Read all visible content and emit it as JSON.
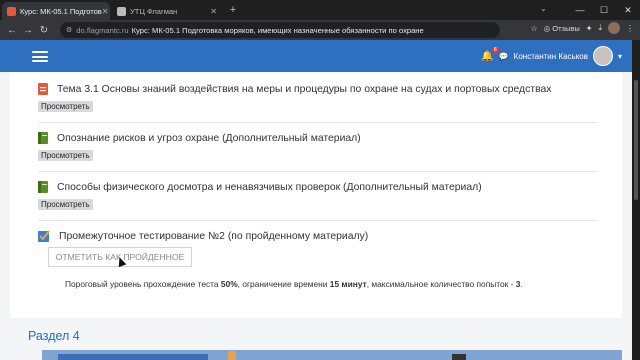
{
  "browser": {
    "tabs": [
      {
        "title": "Курс: МК-05.1 Подготов",
        "active": true
      },
      {
        "title": "УТЦ Флагман",
        "active": false
      }
    ],
    "new_tab_glyph": "+",
    "address": {
      "domain": "do.flagmantc.ru",
      "page_title": "Курс: МК-05.1 Подготовка моряков, имеющих назначенные обязанности по охране"
    },
    "reviews_label": "Отзывы"
  },
  "header": {
    "notification_count": "8",
    "user_name": "Константин Каськов",
    "brand_color": "#2f6fc0"
  },
  "activities": [
    {
      "title": "Тема 3.1 Основы знаний воздействия на меры и процедуры по охране на судах и портовых средствах",
      "button": "Просмотреть",
      "icon": "pdf-file-icon"
    },
    {
      "title": "Опознание рисков и угроз охране (Дополнительный материал)",
      "button": "Просмотреть",
      "icon": "book-icon"
    },
    {
      "title": "Способы физического досмотра и ненавязчивых проверок (Дополнительный материал)",
      "button": "Просмотреть",
      "icon": "book-icon"
    },
    {
      "title": "Промежуточное тестирование №2 (по пройденному материалу)",
      "icon": "quiz-icon"
    }
  ],
  "quiz": {
    "mark_done_label": "ОТМЕТИТЬ КАК ПРОЙДЕННОЕ",
    "info": {
      "prefix": "Пороговый уровень прохождение теста ",
      "threshold": "50%",
      "middle": ", ограничение времени ",
      "time_limit": "15 минут",
      "suffix": ", максимальное количество попыток - ",
      "attempts": "3",
      "end": "."
    }
  },
  "next_section": {
    "title": "Раздел 4"
  }
}
